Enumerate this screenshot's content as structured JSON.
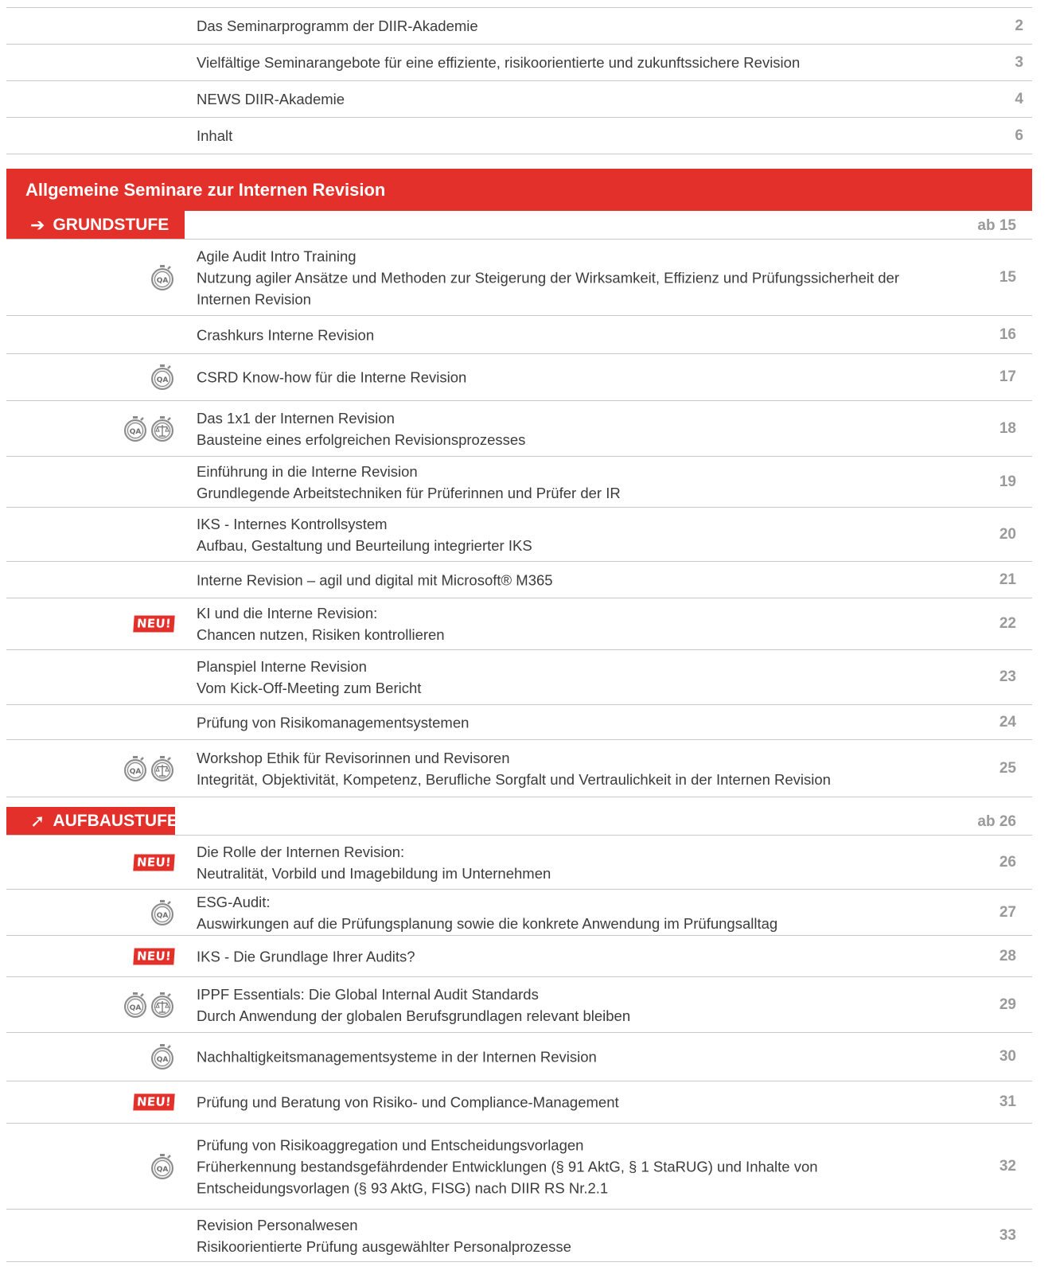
{
  "intro": [
    {
      "title": "Das Seminarprogramm der DIIR-Akademie",
      "page": "2"
    },
    {
      "title": "Vielfältige Seminarangebote für eine effiziente, risikoorientierte und zukunftssichere Revision",
      "page": "3"
    },
    {
      "title": "NEWS DIIR-Akademie",
      "page": "4"
    },
    {
      "title": "Inhalt",
      "page": "6"
    }
  ],
  "section": {
    "title": "Allgemeine Seminare zur Internen Revision"
  },
  "grundstufe": {
    "label": "GRUNDSTUFE",
    "arrow": "➔",
    "page": "ab 15",
    "rows": [
      {
        "lines": [
          "Agile Audit Intro Training",
          "Nutzung agiler Ansätze und Methoden zur Steigerung der Wirksamkeit, Effizienz und Prüfungssicherheit der Internen Revision"
        ],
        "page": "15",
        "icons": [
          "qa-icon"
        ]
      },
      {
        "lines": [
          "Crashkurs Interne Revision"
        ],
        "page": "16",
        "icons": []
      },
      {
        "lines": [
          "CSRD Know-how für die Interne Revision"
        ],
        "page": "17",
        "icons": [
          "qa-icon"
        ]
      },
      {
        "lines": [
          "Das 1x1 der Internen Revision",
          "Bausteine eines erfolgreichen Revisionsprozesses"
        ],
        "page": "18",
        "icons": [
          "qa-icon",
          "ethics-scale-icon"
        ]
      },
      {
        "lines": [
          "Einführung in die Interne Revision",
          "Grundlegende Arbeitstechniken für Prüferinnen und Prüfer der IR"
        ],
        "page": "19",
        "icons": []
      },
      {
        "lines": [
          "IKS - Internes Kontrollsystem",
          "Aufbau, Gestaltung und Beurteilung integrierter IKS"
        ],
        "page": "20",
        "icons": []
      },
      {
        "lines": [
          "Interne Revision – agil und digital mit Microsoft® M365"
        ],
        "page": "21",
        "icons": []
      },
      {
        "lines": [
          "KI und die Interne Revision:",
          "Chancen nutzen, Risiken kontrollieren"
        ],
        "page": "22",
        "icons": [
          "new-badge"
        ]
      },
      {
        "lines": [
          "Planspiel Interne Revision",
          "Vom Kick-Off-Meeting zum Bericht"
        ],
        "page": "23",
        "icons": []
      },
      {
        "lines": [
          "Prüfung von Risikomanagementsystemen"
        ],
        "page": "24",
        "icons": []
      },
      {
        "lines": [
          "Workshop Ethik für Revisorinnen und Revisoren",
          "Integrität, Objektivität, Kompetenz, Berufliche Sorgfalt und Vertraulichkeit in der Internen Revision"
        ],
        "page": "25",
        "icons": [
          "qa-icon",
          "ethics-scale-icon"
        ]
      }
    ]
  },
  "aufbaustufe": {
    "label": "AUFBAUSTUFE",
    "arrow": "➚",
    "page": "ab 26",
    "rows": [
      {
        "lines": [
          "Die Rolle der Internen Revision:",
          "Neutralität, Vorbild und Imagebildung im Unternehmen"
        ],
        "page": "26",
        "icons": [
          "new-badge"
        ]
      },
      {
        "lines": [
          "ESG-Audit:",
          "Auswirkungen auf die Prüfungsplanung sowie die konkrete Anwendung im Prüfungsalltag"
        ],
        "page": "27",
        "icons": [
          "qa-icon"
        ]
      },
      {
        "lines": [
          "IKS - Die Grundlage Ihrer Audits?"
        ],
        "page": "28",
        "icons": [
          "new-badge"
        ]
      },
      {
        "lines": [
          "IPPF Essentials: Die Global Internal Audit Standards",
          "Durch Anwendung der globalen Berufsgrundlagen relevant bleiben"
        ],
        "page": "29",
        "icons": [
          "qa-icon",
          "ethics-scale-icon"
        ]
      },
      {
        "lines": [
          "Nachhaltigkeitsmanagementsysteme in der Internen Revision"
        ],
        "page": "30",
        "icons": [
          "qa-icon"
        ]
      },
      {
        "lines": [
          "Prüfung und Beratung von Risiko- und Compliance-Management"
        ],
        "page": "31",
        "icons": [
          "new-badge"
        ]
      },
      {
        "lines": [
          "Prüfung von Risikoaggregation und Entscheidungsvorlagen",
          "Früherkennung bestandsgefährdender Entwicklungen (§ 91 AktG, § 1 StaRUG) und Inhalte von",
          "Entscheidungsvorlagen (§ 93 AktG, FISG) nach DIIR RS Nr.2.1"
        ],
        "page": "32",
        "icons": [
          "qa-icon"
        ]
      },
      {
        "lines": [
          "Revision Personalwesen",
          "Risikoorientierte Prüfung ausgewählter Personalprozesse"
        ],
        "page": "33",
        "icons": []
      }
    ]
  },
  "labels": {
    "new_badge": "NEU!",
    "qa_glyph": "QA"
  }
}
